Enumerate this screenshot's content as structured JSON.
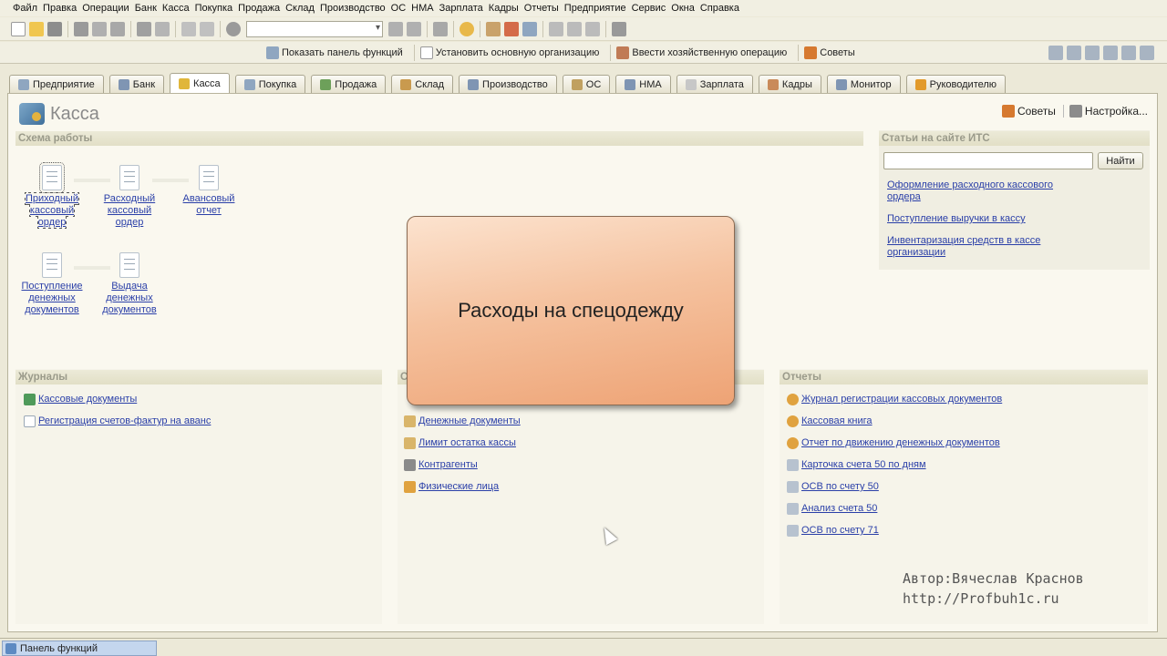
{
  "menu": [
    "Файл",
    "Правка",
    "Операции",
    "Банк",
    "Касса",
    "Покупка",
    "Продажа",
    "Склад",
    "Производство",
    "ОС",
    "НМА",
    "Зарплата",
    "Кадры",
    "Отчеты",
    "Предприятие",
    "Сервис",
    "Окна",
    "Справка"
  ],
  "toolbar2": {
    "show_panel": "Показать панель функций",
    "set_org": "Установить основную организацию",
    "enter_op": "Ввести хозяйственную операцию",
    "tips": "Советы"
  },
  "tabs": [
    "Предприятие",
    "Банк",
    "Касса",
    "Покупка",
    "Продажа",
    "Склад",
    "Производство",
    "ОС",
    "НМА",
    "Зарплата",
    "Кадры",
    "Монитор",
    "Руководителю"
  ],
  "page": {
    "title": "Касса",
    "tips": "Советы",
    "settings": "Настройка..."
  },
  "scheme": {
    "header": "Схема работы",
    "items": [
      {
        "line1": "Приходный",
        "line2": "кассовый",
        "line3": "ордер"
      },
      {
        "line1": "Расходный",
        "line2": "кассовый",
        "line3": "ордер"
      },
      {
        "line1": "Авансовый",
        "line2": "отчет",
        "line3": ""
      },
      {
        "line1": "Поступление",
        "line2": "денежных",
        "line3": "документов"
      },
      {
        "line1": "Выдача",
        "line2": "денежных",
        "line3": "документов"
      }
    ]
  },
  "its": {
    "header": "Статьи на сайте ИТС",
    "search_value": "",
    "find_button": "Найти",
    "links": [
      {
        "line1": "Оформление расходного кассового",
        "line2": "ордера"
      },
      {
        "line1": "Поступление выручки в кассу",
        "line2": ""
      },
      {
        "line1": "Инвентаризация средств в кассе",
        "line2": "организации"
      }
    ]
  },
  "journals": {
    "header": "Журналы",
    "items": [
      "Кассовые документы",
      "Регистрация счетов-фактур на аванс"
    ]
  },
  "refs": {
    "header": "С",
    "items": [
      "Денежные документы",
      "Лимит остатка кассы",
      "Контрагенты",
      "Физические лица"
    ]
  },
  "reports": {
    "header": "Отчеты",
    "items": [
      "Журнал регистрации кассовых документов",
      "Кассовая книга",
      "Отчет по движению денежных документов",
      "Карточка счета 50 по дням",
      "ОСВ по счету 50",
      "Анализ счета 50",
      "ОСВ по счету 71"
    ]
  },
  "overlay": {
    "text": "Расходы на спецодежду"
  },
  "watermark": {
    "line1": "Автор:Вячеслав Краснов",
    "line2": "http://Profbuh1c.ru"
  },
  "status": {
    "panel": "Панель функций"
  }
}
